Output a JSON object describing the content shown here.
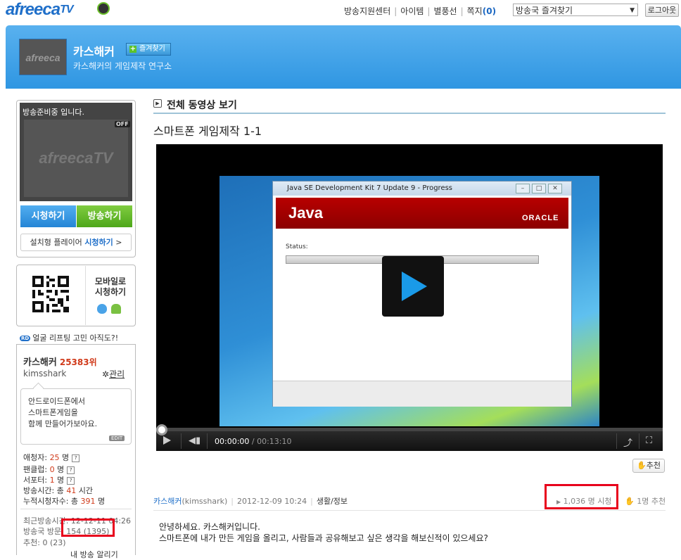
{
  "topbar": {
    "logo_text": "afreeca",
    "logo_tv": "TV",
    "nav": [
      "방송지원센터",
      "아이템",
      "별풍선",
      "쪽지"
    ],
    "message_count": "(0)",
    "fav_select": "방송국 즐겨찾기",
    "logout": "로그아웃"
  },
  "channel": {
    "thumb_text": "afreeca",
    "name": "카스해커",
    "fav_button": "즐겨찾기",
    "description": "카스해커의 게임제작 연구소"
  },
  "broadcast": {
    "status": "방송준비중 입니다.",
    "screen_logo": "afreecaTV",
    "off_badge": "OFF",
    "watch_button": "시청하기",
    "broadcast_button": "방송하기",
    "player_link_prefix": "설치형 플레이어",
    "player_link_action": "시청하기",
    "player_link_arrow": ">"
  },
  "mobile": {
    "line1": "모바일로",
    "line2": "시청하기"
  },
  "notice": {
    "badge": "RD",
    "text": "얼굴 리프팅 고민 아직도?!"
  },
  "profile": {
    "name": "카스해커",
    "rank": "25383위",
    "user_id": "kimsshark",
    "manage": "관리",
    "bubble_line1": "안드로이드폰에서",
    "bubble_line2": "스마트폰게임을",
    "bubble_line3": "함께 만들어가보아요.",
    "edit": "EDIT",
    "stats": [
      {
        "label": "애청자: ",
        "value": "25",
        "unit": " 명"
      },
      {
        "label": "팬클럽: ",
        "value": "0",
        "unit": " 명"
      },
      {
        "label": "서포터: ",
        "value": "1",
        "unit": " 명"
      }
    ],
    "airtime_label": "방송시간: 총 ",
    "airtime_value": "41",
    "airtime_unit": " 시간",
    "cumulative_label": "누적시청자수: 총 ",
    "cumulative_value": "391",
    "cumulative_unit": " 명",
    "recent": "최근방송시간: 12-12-11 04:26",
    "visits": "방송국 방문: 154 (1395)",
    "recommend": "추천: 0 (23)",
    "more": "내 방송 알리기"
  },
  "main": {
    "section_title": "전체 동영상 보기",
    "video_title": "스마트폰 게임제작 1-1",
    "dialog_title": "Java SE Development Kit 7 Update 9 - Progress",
    "java_logo": "Java",
    "oracle": "ORACLE",
    "status_label": "Status:",
    "time_current": "00:00:00",
    "time_total": " / 00:13:10",
    "recommend_button": "추천",
    "author": "카스해커",
    "author_id": "(kimsshark)",
    "date": "2012-12-09 10:24",
    "category": "생활/정보",
    "views": "1,036 명 시청",
    "rec_count": "1명 추천",
    "body_line1": "안녕하세요. 카스해커입니다.",
    "body_line2": "스마트폰에 내가 만든 게임을 올리고, 사람들과 공유해보고 싶은 생각을 해보신적이 있으세요?"
  },
  "colors": {
    "brand_blue": "#1f6fc9",
    "header_blue": "#2f96e2",
    "highlight_red": "#e8001c",
    "rank_red": "#d03a1a"
  }
}
